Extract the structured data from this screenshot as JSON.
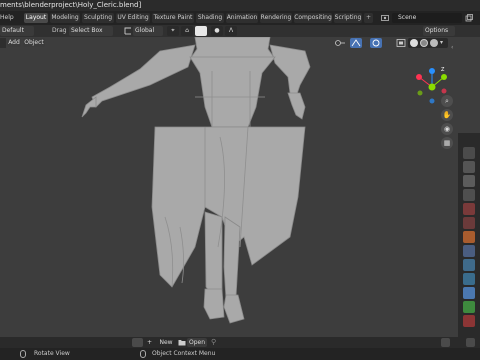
{
  "title_bar": {
    "text": "ments\\blenderproject\\Holy_Cleric.blend]"
  },
  "top_menu": {
    "help_label": "Help",
    "workspaces": [
      "Layout",
      "Modeling",
      "Sculpting",
      "UV Editing",
      "Texture Paint",
      "Shading",
      "Animation",
      "Rendering",
      "Compositing",
      "Scripting"
    ],
    "active_workspace": "Layout",
    "add_workspace": "+",
    "scene_name": "Scene"
  },
  "tool_header": {
    "mode": "Default",
    "drag_label": "Drag",
    "select_mode": "Select Box",
    "orientation": "Global",
    "options_label": "Options"
  },
  "viewport_header": {
    "add_label": "Add",
    "object_label": "Object"
  },
  "navigation_gizmo": {
    "x_label": "X",
    "y_label": "Y",
    "z_label": "Z"
  },
  "footer": {
    "new_label": "New",
    "open_label": "Open"
  },
  "status_bar": {
    "left_hint": "Rotate View",
    "right_hint": "Object Context Menu"
  },
  "colors": {
    "viewport_bg": "#3d3d3d",
    "accent_blue": "#4772b3",
    "axis_x": "#ff3352",
    "axis_y": "#8bdc00",
    "axis_z": "#2890ff"
  }
}
